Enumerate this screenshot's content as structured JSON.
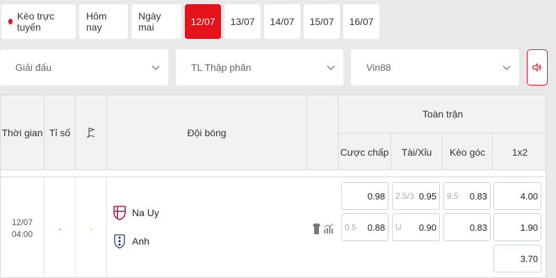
{
  "tabs": {
    "live": "Kèo trực tuyến",
    "items": [
      "Hôm nay",
      "Ngày mai",
      "12/07",
      "13/07",
      "14/07",
      "15/07",
      "16/07"
    ],
    "active": "12/07"
  },
  "filters": {
    "league": "Giải đấu",
    "odds_format": "TL Thập phân",
    "bookmaker": "Vin88"
  },
  "table": {
    "headers": {
      "time": "Thời gian",
      "score": "Tỉ số",
      "teams": "Đội bóng",
      "full_match": "Toàn trận",
      "handicap": "Cược chấp",
      "over_under": "Tài/Xỉu",
      "corner": "Kèo góc",
      "one_x_two": "1x2"
    },
    "match": {
      "date": "12/07",
      "time": "04:00",
      "score": "-",
      "corner_score": "-",
      "home": "Na Uy",
      "away": "Anh",
      "handicap": {
        "home_line": "",
        "home_odds": "0.98",
        "away_line": "0.5",
        "away_odds": "0.88"
      },
      "over_under": {
        "line": "2.5/3",
        "over_odds": "0.95",
        "under_label": "U",
        "under_odds": "0.90"
      },
      "corner": {
        "line": "9.5",
        "over_odds": "0.83",
        "under_odds": "0.83"
      },
      "one_x_two": {
        "home": "4.00",
        "away": "1.90",
        "draw": "3.70"
      }
    }
  },
  "colors": {
    "accent": "#e3141c",
    "odds_border": "#c9d8cc"
  },
  "icons": [
    "live-dot-icon",
    "chevron-down-icon",
    "sound-icon",
    "corner-flag-icon",
    "norway-crest-icon",
    "england-crest-icon",
    "jersey-icon",
    "stats-icon"
  ]
}
